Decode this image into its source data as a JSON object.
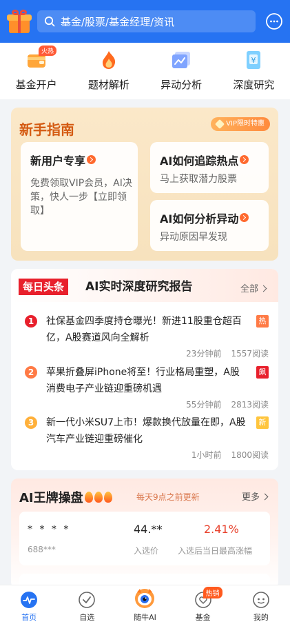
{
  "header": {
    "search_placeholder": "基金/股票/基金经理/资讯",
    "colors": {
      "primary": "#2673f2"
    }
  },
  "quick_nav": [
    {
      "label": "基金开户",
      "icon": "wallet-icon",
      "tag": "火热"
    },
    {
      "label": "题材解析",
      "icon": "flame-icon"
    },
    {
      "label": "异动分析",
      "icon": "trend-chart-icon"
    },
    {
      "label": "深度研究",
      "icon": "yen-document-icon"
    }
  ],
  "guide": {
    "title": "新手指南",
    "vip_badge": "VIP限时特惠",
    "cards": [
      {
        "title": "新用户专享",
        "desc": "免费领取VIP会员，AI决策，快人一步【立即领取】"
      },
      {
        "title": "AI如何追踪热点",
        "desc": "马上获取潜力股票"
      },
      {
        "title": "AI如何分析异动",
        "desc": "异动原因早发现"
      }
    ]
  },
  "news": {
    "tag": "每日头条",
    "title": "AI实时深度研究报告",
    "all_label": "全部",
    "items": [
      {
        "rank": "1",
        "text": "社保基金四季度持仓曝光！新进11股重仓超百亿，A股赛道风向全解析",
        "badge": "热",
        "time": "23分钟前",
        "reads": "1557阅读",
        "rank_color": "#e8202c",
        "badge_color": "#ff7a45"
      },
      {
        "rank": "2",
        "text": "苹果折叠屏iPhone将至！行业格局重塑，A股消费电子产业链迎重磅机遇",
        "badge": "飙",
        "time": "55分钟前",
        "reads": "2813阅读",
        "rank_color": "#ff7a45",
        "badge_color": "#e8202c"
      },
      {
        "rank": "3",
        "text": "新一代小米SU7上市！爆款换代放量在即，A股汽车产业链迎重磅催化",
        "badge": "新",
        "time": "1小时前",
        "reads": "1800阅读",
        "rank_color": "#ffb03a",
        "badge_color": "#ffc53d"
      }
    ]
  },
  "ai_trading": {
    "title": "AI王牌操盘",
    "subtitle": "每天9点之前更新",
    "more_label": "更多",
    "stock": {
      "name": "* * * *",
      "code": "688***",
      "price": "44.**",
      "price_label": "入选价",
      "pct": "2.41%",
      "pct_label": "入选后当日最高涨幅"
    }
  },
  "tabbar": [
    {
      "label": "首页",
      "icon": "home-pulse-icon",
      "active": true
    },
    {
      "label": "自选",
      "icon": "check-circle-icon"
    },
    {
      "label": "随牛AI",
      "icon": "mascot-icon"
    },
    {
      "label": "基金",
      "icon": "fund-heart-icon",
      "tag": "热销"
    },
    {
      "label": "我的",
      "icon": "profile-face-icon"
    }
  ]
}
